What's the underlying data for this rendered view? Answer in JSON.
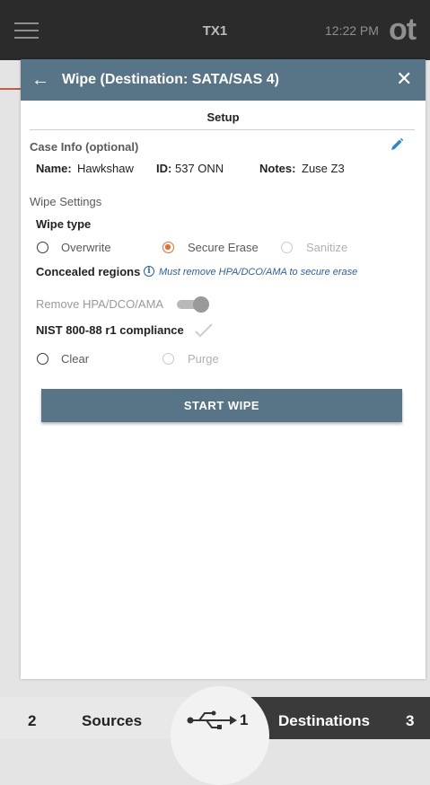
{
  "app_bar": {
    "device": "TX1",
    "time": "12:22 PM",
    "logo": "ot"
  },
  "dialog": {
    "title": "Wipe (Destination: SATA/SAS 4)",
    "section_title": "Setup",
    "case_info": {
      "heading": "Case Info (optional)",
      "name_label": "Name:",
      "name_value": "Hawkshaw",
      "id_label": "ID:",
      "id_value": "537 ONN",
      "notes_label": "Notes:",
      "notes_value": "Zuse Z3"
    },
    "wipe_settings": {
      "heading": "Wipe Settings",
      "wipe_type_label": "Wipe type",
      "options": [
        {
          "label": "Overwrite",
          "selected": false,
          "enabled": true
        },
        {
          "label": "Secure Erase",
          "selected": true,
          "enabled": true
        },
        {
          "label": "Sanitize",
          "selected": false,
          "enabled": false
        }
      ],
      "concealed_label": "Concealed regions",
      "concealed_note": "Must remove HPA/DCO/AMA to secure erase",
      "remove_label": "Remove HPA/DCO/AMA",
      "remove_toggle_on": true,
      "nist_label": "NIST 800-88 r1 compliance",
      "nist_options": [
        {
          "label": "Clear",
          "selected": false,
          "enabled": true
        },
        {
          "label": "Purge",
          "selected": false,
          "enabled": false
        }
      ]
    },
    "start_button": "START WIPE"
  },
  "bottom_nav": {
    "sources_count": "2",
    "sources_label": "Sources",
    "usb_count": "1",
    "destinations_label": "Destinations",
    "destinations_count": "3"
  },
  "colors": {
    "accent": "#577587",
    "selected": "#f06a2b",
    "edit": "#2a86d1"
  },
  "icons": [
    "menu-icon",
    "back-arrow-icon",
    "close-icon",
    "edit-pencil-icon",
    "info-icon",
    "check-icon",
    "usb-icon"
  ]
}
